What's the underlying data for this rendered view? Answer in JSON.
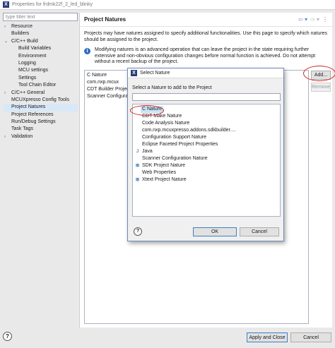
{
  "window": {
    "title": "Properties for frdmk22f_2_led_blinky"
  },
  "filter": {
    "placeholder": "type filter text"
  },
  "tree": [
    {
      "label": "Resource",
      "arrow": "›",
      "indent": 0,
      "selected": false
    },
    {
      "label": "Builders",
      "arrow": "",
      "indent": 0,
      "selected": false
    },
    {
      "label": "C/C++ Build",
      "arrow": "⌄",
      "indent": 0,
      "selected": false
    },
    {
      "label": "Build Variables",
      "arrow": "",
      "indent": 1,
      "selected": false
    },
    {
      "label": "Environment",
      "arrow": "",
      "indent": 1,
      "selected": false
    },
    {
      "label": "Logging",
      "arrow": "",
      "indent": 1,
      "selected": false
    },
    {
      "label": "MCU settings",
      "arrow": "",
      "indent": 1,
      "selected": false
    },
    {
      "label": "Settings",
      "arrow": "",
      "indent": 1,
      "selected": false
    },
    {
      "label": "Tool Chain Editor",
      "arrow": "",
      "indent": 1,
      "selected": false
    },
    {
      "label": "C/C++ General",
      "arrow": "›",
      "indent": 0,
      "selected": false
    },
    {
      "label": "MCUXpresso Config Tools",
      "arrow": "",
      "indent": 0,
      "selected": false
    },
    {
      "label": "Project Natures",
      "arrow": "",
      "indent": 0,
      "selected": true
    },
    {
      "label": "Project References",
      "arrow": "",
      "indent": 0,
      "selected": false
    },
    {
      "label": "Run/Debug Settings",
      "arrow": "",
      "indent": 0,
      "selected": false
    },
    {
      "label": "Task Tags",
      "arrow": "",
      "indent": 0,
      "selected": false
    },
    {
      "label": "Validation",
      "arrow": "›",
      "indent": 0,
      "selected": false
    }
  ],
  "page": {
    "title": "Project Natures",
    "description": "Projects may have natures assigned to specify additional functionalities. Use this page to specify which natures should be assigned to the project.",
    "warning": "Modifying natures is an advanced operation that can leave the project in the state requiring further extensive and non-obvious configuration changes before normal function is achieved. Do not attempt without a recent backup of the project.",
    "natures": [
      "C Nature",
      "com.nxp.mcux",
      "CDT Builder Project",
      "Scanner Configura"
    ],
    "add_label": "Add...",
    "remove_label": "Remove",
    "apply_close_label": "Apply and Close",
    "cancel_label": "Cancel"
  },
  "dialog": {
    "title": "Select Nature",
    "prompt": "Select a Nature to add to the Project",
    "items": [
      {
        "label": "C Nature",
        "mark": "",
        "selected": true
      },
      {
        "label": "CDT Make Nature",
        "mark": "",
        "selected": false
      },
      {
        "label": "Code Analysis Nature",
        "mark": "",
        "selected": false
      },
      {
        "label": "com.nxp.mcuxpresso.addons.sdkbuilder....",
        "mark": "",
        "selected": false
      },
      {
        "label": "Configuration Support Nature",
        "mark": "",
        "selected": false
      },
      {
        "label": "Eclipse Faceted Project Properties",
        "mark": "",
        "selected": false
      },
      {
        "label": "Java",
        "mark": "J",
        "selected": false
      },
      {
        "label": "Scanner Configuration Nature",
        "mark": "",
        "selected": false
      },
      {
        "label": "SDK Project Nature",
        "mark": "⊞",
        "selected": false
      },
      {
        "label": "Web Properties",
        "mark": "",
        "selected": false
      },
      {
        "label": "Xtext Project Nature",
        "mark": "⊞",
        "selected": false
      }
    ],
    "ok_label": "OK",
    "cancel_label": "Cancel"
  },
  "icons": {
    "app": "eclipse-icon",
    "back": "back-arrow-icon",
    "forward": "forward-arrow-icon",
    "menu": "view-menu-icon",
    "help": "help-icon",
    "info": "info-icon"
  },
  "colors": {
    "accent": "#2f6dc0",
    "highlight": "#d42020",
    "selection": "#cce4f7"
  }
}
